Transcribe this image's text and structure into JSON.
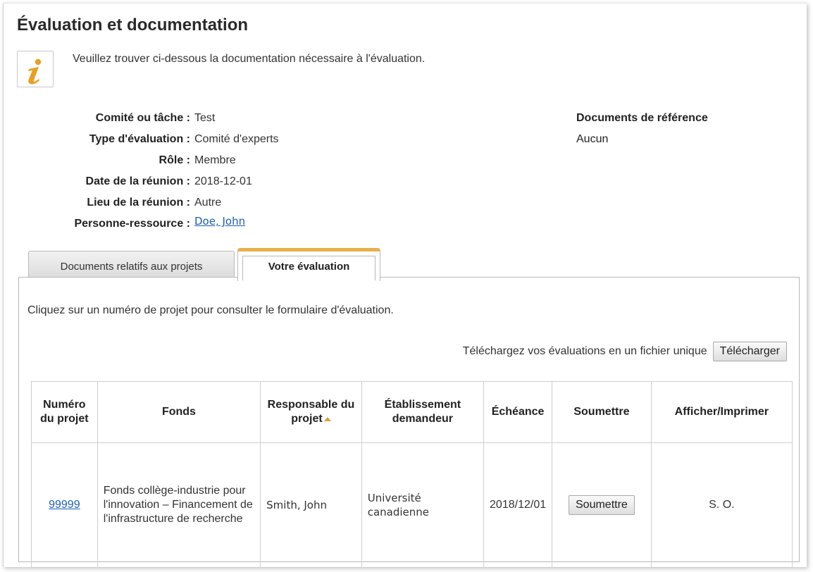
{
  "page": {
    "title": "Évaluation et documentation",
    "info_message": "Veuillez trouver ci-dessous la documentation nécessaire à l'évaluation."
  },
  "meta": [
    {
      "label": "Comité ou tâche :",
      "value": "Test"
    },
    {
      "label": "Type d'évaluation :",
      "value": "Comité d'experts"
    },
    {
      "label": "Rôle :",
      "value": "Membre"
    },
    {
      "label": "Date de la réunion :",
      "value": "2018-12-01"
    },
    {
      "label": "Lieu de la réunion :",
      "value": "Autre"
    },
    {
      "label": "Personne-ressource :",
      "value": "Doe, John"
    }
  ],
  "reference_documents": {
    "heading": "Documents de référence",
    "value": "Aucun"
  },
  "tabs": [
    {
      "label": "Documents relatifs aux projets",
      "active": false
    },
    {
      "label": "Votre évaluation",
      "active": true
    }
  ],
  "panel": {
    "intro": "Cliquez sur un numéro de projet pour consulter le formulaire d'évaluation.",
    "download_text": "Téléchargez vos évaluations en un fichier unique",
    "download_button": "Télécharger"
  },
  "table": {
    "headers": [
      "Numéro du projet",
      "Fonds",
      "Responsable du projet",
      "Établissement demandeur",
      "Échéance",
      "Soumettre",
      "Afficher/Imprimer"
    ],
    "sorted_column": "Responsable du projet",
    "rows": [
      {
        "project_number": "99999",
        "fund": "Fonds collège-industrie pour l'innovation – Financement de l'infrastructure de recherche",
        "lead": "Smith, John",
        "institution": "Université canadienne",
        "deadline": "2018/12/01",
        "submit_button": "Soumettre",
        "view_print": "S. O."
      }
    ]
  },
  "colors": {
    "link": "#1a5fb4",
    "active_tab_accent": "#e8b04a",
    "info_icon": "#e8a020"
  }
}
